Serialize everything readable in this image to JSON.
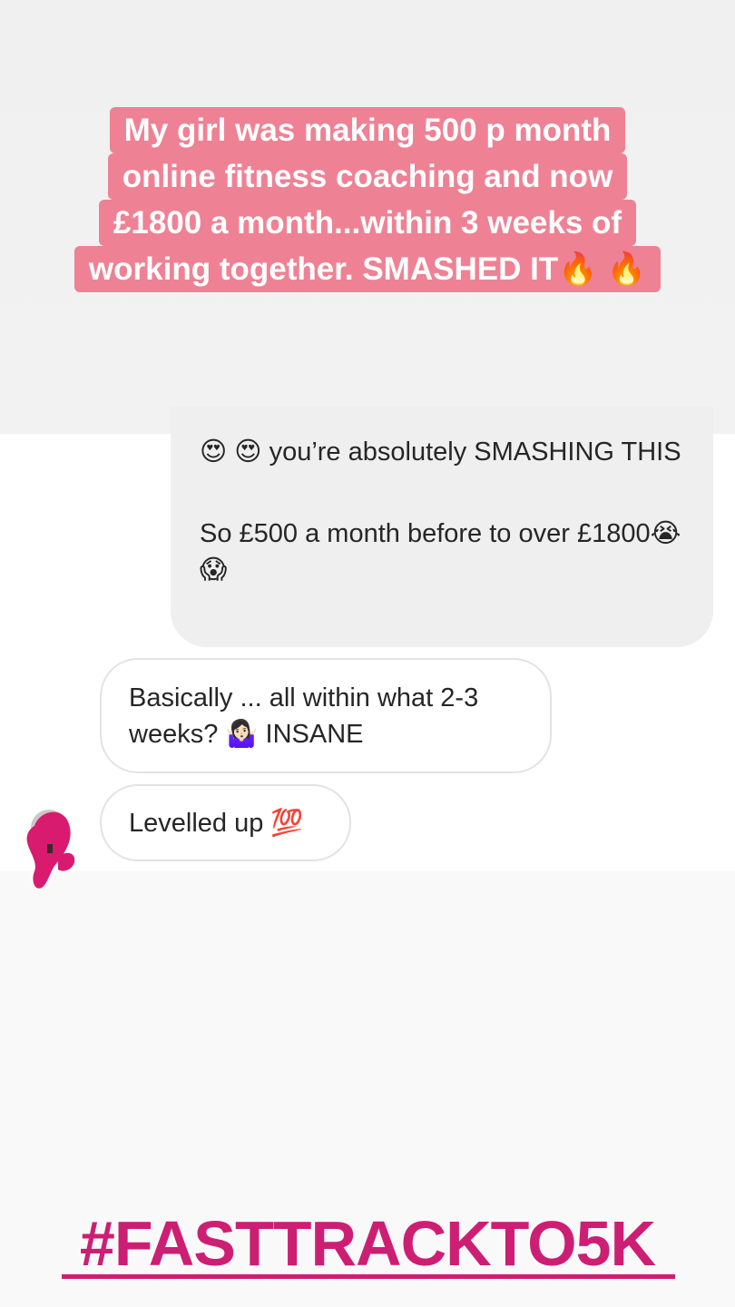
{
  "caption": {
    "lines": [
      "My girl was making 500 p month",
      "online fitness coaching and now",
      "£1800 a month...within 3 weeks of",
      "working together. SMASHED IT🔥 🔥"
    ]
  },
  "messages": {
    "sent": {
      "paragraph1": "😍 😍  you’re absolutely SMASHING THIS",
      "paragraph2": "So £500 a month before to over £1800😭 😱"
    },
    "received": [
      {
        "text": "Basically ... all within what 2-3 weeks? 🤷🏻‍♀️ INSANE"
      },
      {
        "text": "Levelled up 💯"
      }
    ]
  },
  "avatar": {
    "icon": "profile-avatar-icon"
  },
  "hashtag": "#FASTTRACKTO5K",
  "colors": {
    "caption_bg": "#ee8294",
    "hashtag": "#cc1f73",
    "sent_bubble": "#efefef",
    "scribble": "#d81b6f"
  }
}
